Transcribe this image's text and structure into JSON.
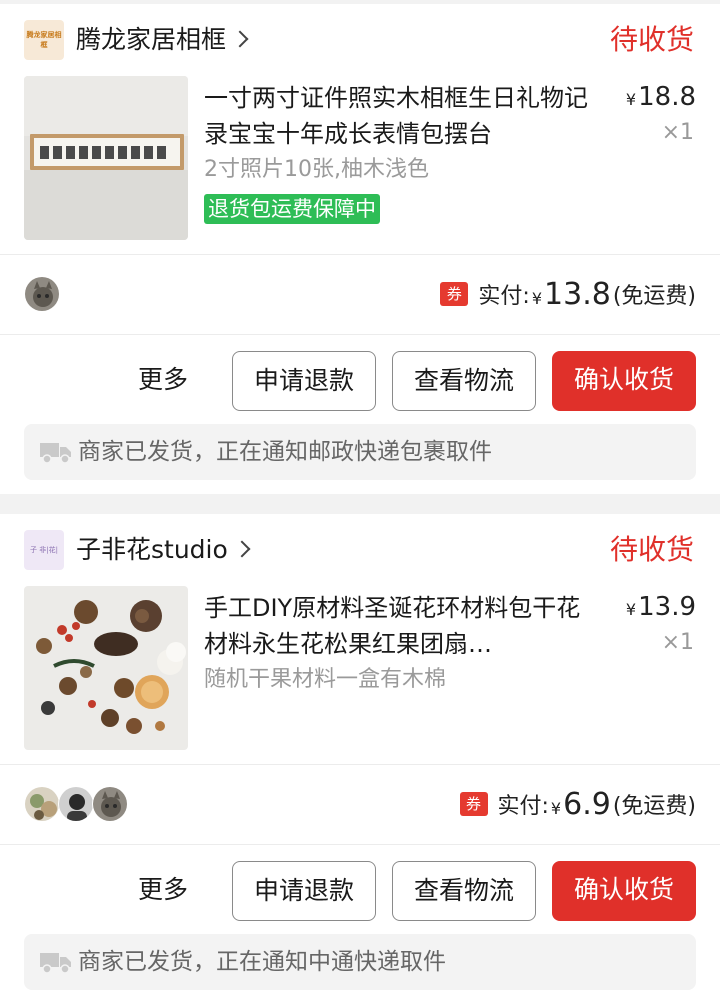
{
  "orders": [
    {
      "shop_logo_text": "腾龙家居相框",
      "shop_name": "腾龙家居相框",
      "status": "待收货",
      "product_title": "一寸两寸证件照实木相框生日礼物记录宝宝十年成长表情包摆台",
      "price_symbol": "¥",
      "price": "18.8",
      "quantity": "×1",
      "sku": "2寸照片10张,柚木浅色",
      "guarantee_badge": "退货包运费保障中",
      "coupon_icon_text": "券",
      "paid_label": "实付:",
      "paid_symbol": "¥",
      "paid_amount": "13.8",
      "shipping_note": "(免运费)",
      "buttons": {
        "more": "更多",
        "refund": "申请退款",
        "logistics": "查看物流",
        "confirm": "确认收货"
      },
      "notice": "商家已发货，正在通知邮政快递包裹取件"
    },
    {
      "shop_logo_text": "子 非|花|",
      "shop_name": "子非花studio",
      "status": "待收货",
      "product_title": "手工DIY原材料圣诞花环材料包干花材料永生花松果红果团扇…",
      "price_symbol": "¥",
      "price": "13.9",
      "quantity": "×1",
      "sku": "随机干果材料一盒有木棉",
      "coupon_icon_text": "券",
      "paid_label": "实付:",
      "paid_symbol": "¥",
      "paid_amount": "6.9",
      "shipping_note": "(免运费)",
      "buttons": {
        "more": "更多",
        "refund": "申请退款",
        "logistics": "查看物流",
        "confirm": "确认收货"
      },
      "notice": "商家已发货，正在通知中通快递取件"
    }
  ],
  "colors": {
    "accent_red": "#e0302a",
    "guarantee_green": "#2ebd56",
    "muted_text": "#9a9a9a",
    "page_bg": "#f2f2f2"
  },
  "icons": [
    "chevron-right-icon",
    "coupon-icon",
    "truck-icon",
    "avatar"
  ]
}
